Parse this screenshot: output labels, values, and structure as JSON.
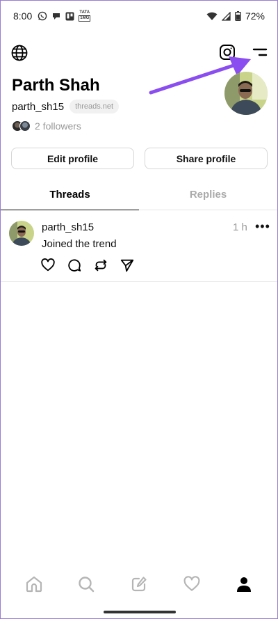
{
  "status_bar": {
    "time": "8:00",
    "tata_label_top": "TATA",
    "tata_label_bottom": "1MG",
    "battery": "72%"
  },
  "profile": {
    "name": "Parth Shah",
    "handle": "parth_sh15",
    "domain": "threads.net",
    "followers": "2 followers"
  },
  "buttons": {
    "edit": "Edit profile",
    "share": "Share profile"
  },
  "tabs": [
    {
      "label": "Threads",
      "active": true
    },
    {
      "label": "Replies",
      "active": false
    }
  ],
  "post": {
    "user": "parth_sh15",
    "time": "1 h",
    "more": "•••",
    "text": "Joined the trend"
  },
  "colors": {
    "accent_arrow": "#8a4df0",
    "frame_border": "#9a7bd6"
  },
  "icons": {
    "header": [
      "globe-icon",
      "instagram-icon",
      "menu-icon"
    ],
    "post_actions": [
      "heart-icon",
      "comment-icon",
      "repost-icon",
      "send-icon"
    ],
    "bottom_nav": [
      "home-icon",
      "search-icon",
      "compose-icon",
      "activity-heart-icon",
      "profile-icon"
    ]
  }
}
